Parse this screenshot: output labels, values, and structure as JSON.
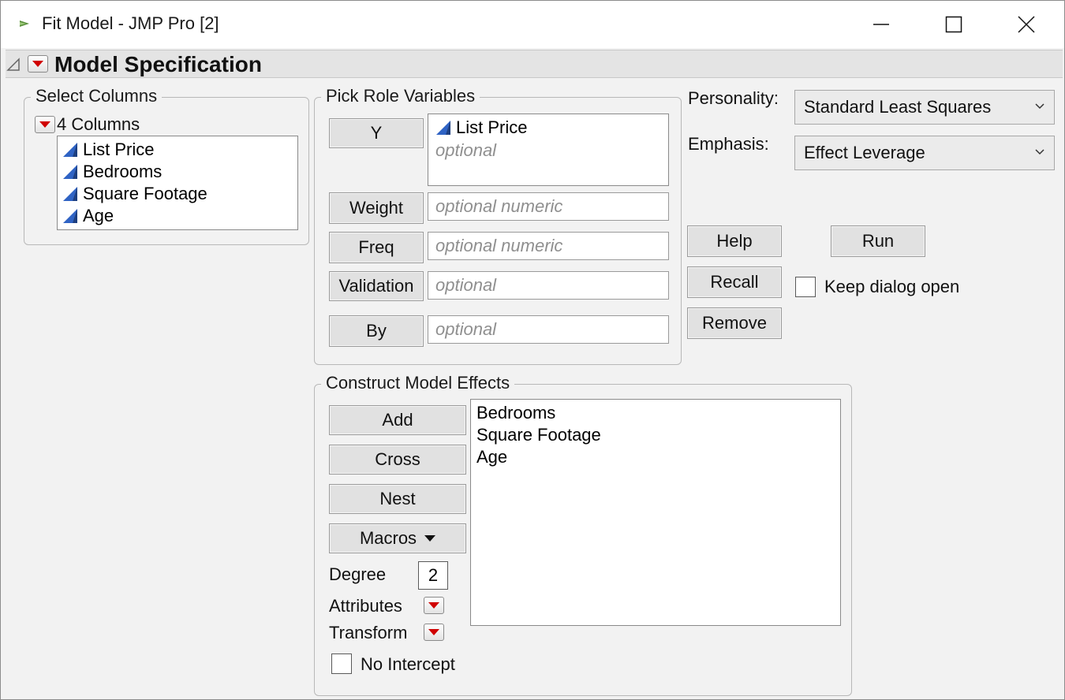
{
  "window": {
    "title": "Fit Model - JMP Pro [2]",
    "controls": [
      "minimize-icon",
      "maximize-icon",
      "close-icon"
    ]
  },
  "outline": {
    "title": "Model Specification"
  },
  "select_columns": {
    "title": "Select Columns",
    "count_label": "4 Columns",
    "columns": [
      "List Price",
      "Bedrooms",
      "Square Footage",
      "Age"
    ]
  },
  "pick_roles": {
    "title": "Pick Role Variables",
    "roles": [
      {
        "button": "Y",
        "value": "List Price",
        "placeholder": "optional"
      },
      {
        "button": "Weight",
        "placeholder": "optional numeric"
      },
      {
        "button": "Freq",
        "placeholder": "optional numeric"
      },
      {
        "button": "Validation",
        "placeholder": "optional"
      },
      {
        "button": "By",
        "placeholder": "optional"
      }
    ]
  },
  "settings": {
    "personality_label": "Personality:",
    "personality_value": "Standard Least Squares",
    "emphasis_label": "Emphasis:",
    "emphasis_value": "Effect Leverage"
  },
  "actions": {
    "help": "Help",
    "run": "Run",
    "recall": "Recall",
    "remove": "Remove",
    "keep_open_label": "Keep dialog open",
    "keep_open_checked": false
  },
  "construct": {
    "title": "Construct Model Effects",
    "add": "Add",
    "cross": "Cross",
    "nest": "Nest",
    "macros": "Macros",
    "degree_label": "Degree",
    "degree_value": "2",
    "attributes_label": "Attributes",
    "transform_label": "Transform",
    "no_intercept_label": "No Intercept",
    "no_intercept_checked": false,
    "effects": [
      "Bedrooms",
      "Square Footage",
      "Age"
    ]
  },
  "colors": {
    "accent_red": "#d00000",
    "continuous_icon_blue": "#2f63c4",
    "panel_bg": "#f2f2f2"
  }
}
